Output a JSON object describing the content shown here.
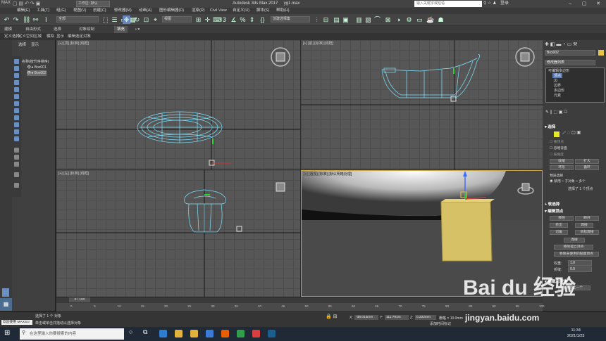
{
  "title_bar": {
    "workspace_label": "工作区: 默认",
    "app_title": "Autodesk 3ds Max 2017",
    "file_name": "yg1.max",
    "search_placeholder": "输入关键字或短语",
    "user_label": "登录"
  },
  "menu": [
    "编辑(E)",
    "工具(T)",
    "组(G)",
    "视图(V)",
    "创建(C)",
    "修改器(M)",
    "动画(A)",
    "图形编辑器(D)",
    "渲染(R)",
    "Civil View",
    "自定义(U)",
    "脚本(S)",
    "帮助(H)"
  ],
  "toolbar": {
    "filter_select": "全部",
    "view_select": "视图",
    "named_sel_select": "创建选择集"
  },
  "ribbon_tabs": [
    "建模",
    "自由形式",
    "选择",
    "对象绘制",
    "填充"
  ],
  "ribbon_sub": [
    "多边形建模",
    "修改选择",
    "编辑",
    "几何体(全部)",
    "细分",
    "三角剖分",
    "对齐",
    "可见性",
    "属性"
  ],
  "ribbon_sub_row": [
    "定义选择",
    "定义空间区域",
    "模拟",
    "显示",
    "编辑选定对象"
  ],
  "scene_explorer": {
    "tabs": [
      "选择",
      "显示"
    ],
    "header": "名称(按升序排序)",
    "items": [
      "Box001",
      "Box002"
    ]
  },
  "viewports": {
    "top": "[+] [顶] [标准] [线框]",
    "front": "[+] [前] [标准] [线框]",
    "left": "[+] [左] [标准] [线框]",
    "perspective": "[+] [透视] [标准] [默认明暗处理]"
  },
  "command_panel": {
    "object_name": "Box002",
    "modifier_list": "修改器列表",
    "stack": [
      "可编辑多边形",
      "顶点",
      "边",
      "边界",
      "多边形",
      "元素"
    ],
    "selection_title": "选择",
    "by_vertex": "按顶点",
    "ignore_backfacing": "忽略背面",
    "by_angle": "按角度",
    "shrink": "收缩",
    "grow": "扩大",
    "ring": "环形",
    "loop": "循环",
    "preview_selection": "预览选择",
    "preview_opts": [
      "禁用",
      "子对象",
      "多个"
    ],
    "selection_status": "选择了 1 个顶点",
    "soft_selection": "软选择",
    "edit_vertices": "编辑顶点",
    "remove": "移除",
    "break": "断开",
    "extrude": "挤出",
    "weld": "焊接",
    "chamfer": "切角",
    "target_weld": "目标焊接",
    "connect": "连接",
    "remove_isolated": "移除孤立顶点",
    "remove_unused_map": "移除未使用的贴图顶点",
    "weight_label": "权重:",
    "weight_value": "1.0",
    "crease_label": "折缝:",
    "crease_value": "0.0",
    "edit_geometry": "编辑几何体",
    "repeat_last": "重复上一个"
  },
  "timeline": {
    "frame_label": "0 / 100",
    "ticks": [
      "0",
      "5",
      "10",
      "15",
      "20",
      "25",
      "30",
      "35",
      "40",
      "45",
      "50",
      "55",
      "60",
      "65",
      "70",
      "75",
      "80",
      "85",
      "90",
      "95",
      "100"
    ]
  },
  "status": {
    "welcome": "欢迎使用 MAXScr",
    "selected": "选择了 1 个 对象",
    "hint": "单击或单击并拖动以选择对象",
    "x_label": "X:",
    "x_value": "-38.014mm",
    "y_label": "Y:",
    "y_value": "111.791m",
    "z_label": "Z:",
    "z_value": "0.222mm",
    "grid": "栅格 = 10.0mm",
    "add_time_tag": "添加时间标记"
  },
  "taskbar": {
    "search_placeholder": "在这里输入你要搜索的内容",
    "time": "11:34",
    "date": "2021/1/23"
  },
  "watermark": {
    "brand": "Bai du 经验",
    "url": "jingyan.baidu.com"
  },
  "colors": {
    "selection_yellow": "#e8c44a",
    "wireframe_cyan": "#7fe3ff",
    "active_border": "#c9a23a"
  }
}
